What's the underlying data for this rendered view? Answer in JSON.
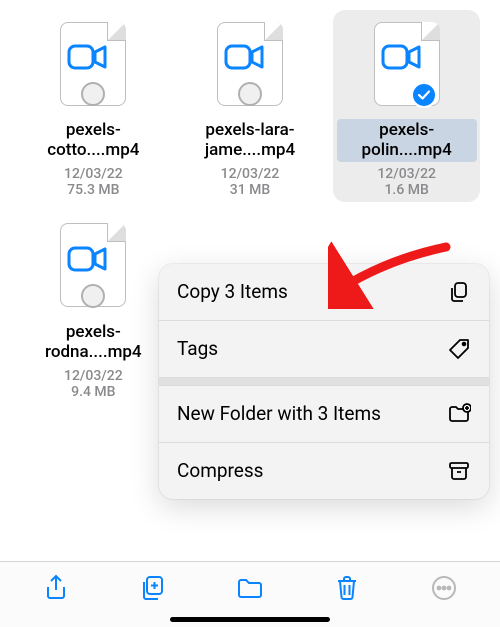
{
  "files": [
    {
      "name": "pexels-cotto....mp4",
      "date": "12/03/22",
      "size": "75.3 MB",
      "selected": false
    },
    {
      "name": "pexels-lara-jame....mp4",
      "date": "12/03/22",
      "size": "31 MB",
      "selected": false
    },
    {
      "name": "pexels-polin....mp4",
      "date": "12/03/22",
      "size": "1.6 MB",
      "selected": true
    },
    {
      "name": "pexels-rodna....mp4",
      "date": "12/03/22",
      "size": "9.4 MB",
      "selected": false
    }
  ],
  "context_menu": {
    "copy": "Copy 3 Items",
    "tags": "Tags",
    "new_folder": "New Folder with 3 Items",
    "compress": "Compress"
  },
  "colors": {
    "accent": "#0a84ff",
    "arrow": "#ee1a1a",
    "disabled": "#b8b8bb"
  }
}
